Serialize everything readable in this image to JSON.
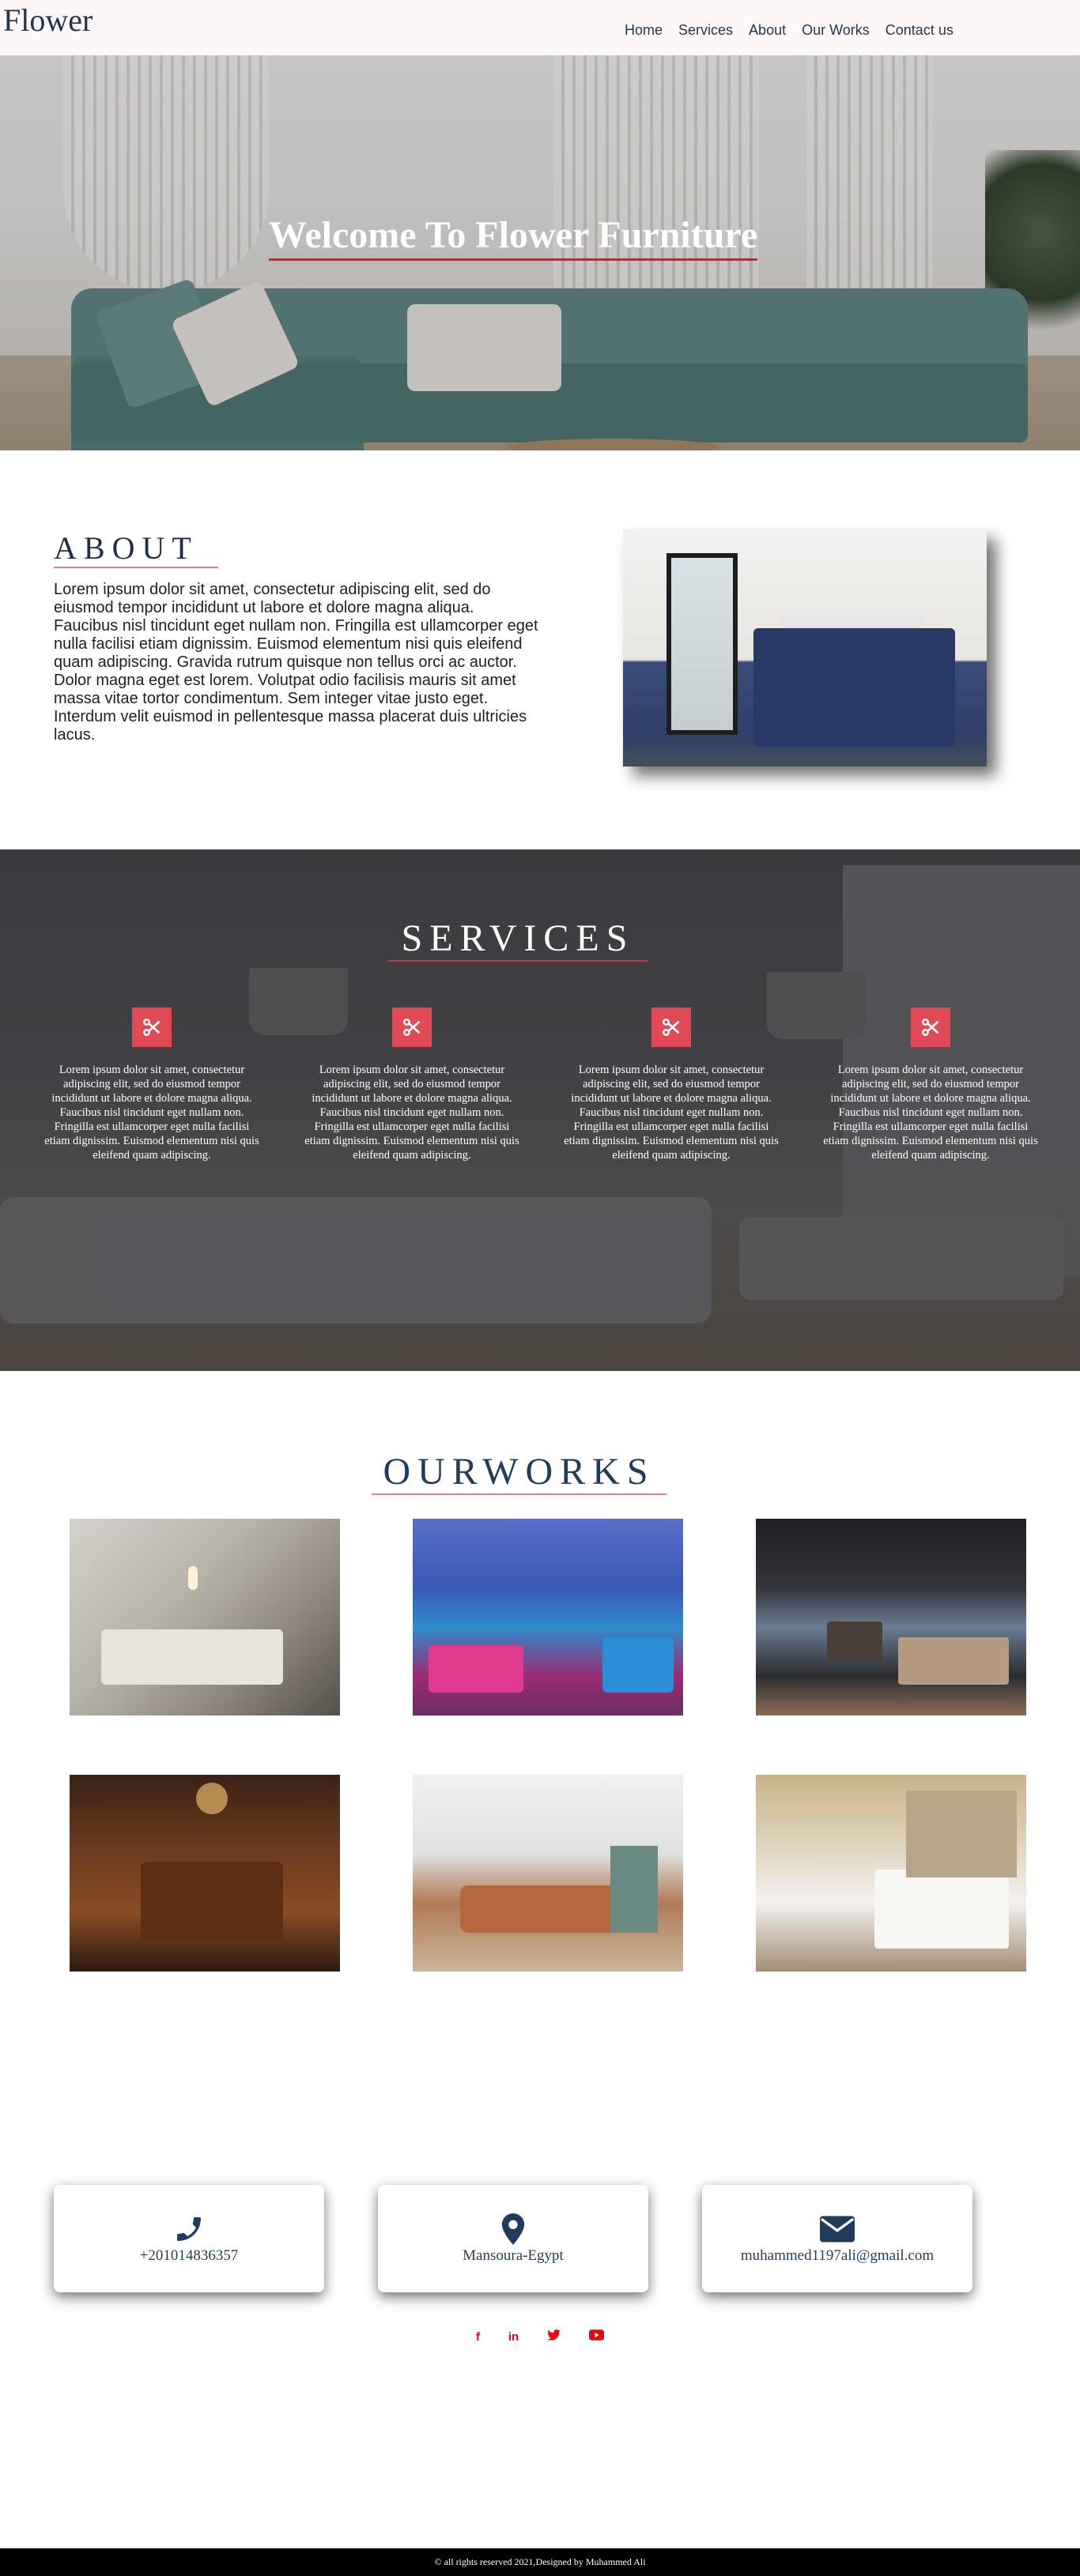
{
  "brand": "Flower",
  "nav": {
    "items": [
      "Home",
      "Services",
      "About",
      "Our Works",
      "Contact us"
    ]
  },
  "hero": {
    "title": "Welcome To Flower Furniture"
  },
  "about": {
    "heading": "ABOUT",
    "text": "Lorem ipsum dolor sit amet, consectetur adipiscing elit, sed do eiusmod tempor incididunt ut labore et dolore magna aliqua. Faucibus nisl tincidunt eget nullam non. Fringilla est ullamcorper eget nulla facilisi etiam dignissim. Euismod elementum nisi quis eleifend quam adipiscing. Gravida rutrum quisque non tellus orci ac auctor. Dolor magna eget est lorem. Volutpat odio facilisis mauris sit amet massa vitae tortor condimentum. Sem integer vitae justo eget. Interdum velit euismod in pellentesque massa placerat duis ultricies lacus."
  },
  "services": {
    "heading": "SERVICES",
    "items": [
      {
        "icon": "scissors-icon",
        "text": "Lorem ipsum dolor sit amet, consectetur adipiscing elit, sed do eiusmod tempor incididunt ut labore et dolore magna aliqua. Faucibus nisl tincidunt eget nullam non. Fringilla est ullamcorper eget nulla facilisi etiam dignissim. Euismod elementum nisi quis eleifend quam adipiscing."
      },
      {
        "icon": "scissors-icon",
        "text": "Lorem ipsum dolor sit amet, consectetur adipiscing elit, sed do eiusmod tempor incididunt ut labore et dolore magna aliqua. Faucibus nisl tincidunt eget nullam non. Fringilla est ullamcorper eget nulla facilisi etiam dignissim. Euismod elementum nisi quis eleifend quam adipiscing."
      },
      {
        "icon": "scissors-icon",
        "text": "Lorem ipsum dolor sit amet, consectetur adipiscing elit, sed do eiusmod tempor incididunt ut labore et dolore magna aliqua. Faucibus nisl tincidunt eget nullam non. Fringilla est ullamcorper eget nulla facilisi etiam dignissim. Euismod elementum nisi quis eleifend quam adipiscing."
      },
      {
        "icon": "scissors-icon",
        "text": "Lorem ipsum dolor sit amet, consectetur adipiscing elit, sed do eiusmod tempor incididunt ut labore et dolore magna aliqua. Faucibus nisl tincidunt eget nullam non. Fringilla est ullamcorper eget nulla facilisi etiam dignissim. Euismod elementum nisi quis eleifend quam adipiscing."
      }
    ]
  },
  "works": {
    "heading": "OURWORKS"
  },
  "contact": {
    "phone": "+201014836357",
    "location": "Mansoura-Egypt",
    "email": "muhammed1197ali@gmail.com"
  },
  "social": {
    "icons": [
      "facebook-icon",
      "linkedin-icon",
      "twitter-icon",
      "youtube-icon"
    ],
    "glyphs": [
      "f",
      "in",
      "t",
      "▶"
    ]
  },
  "footer": {
    "text": "© all rights reserved 2021,Designed by Muhammed Ali"
  },
  "colors": {
    "brand_navy": "#1f3550",
    "accent_red": "#d81e2c",
    "service_icon": "#df4a55",
    "footer_bg": "#000000"
  }
}
